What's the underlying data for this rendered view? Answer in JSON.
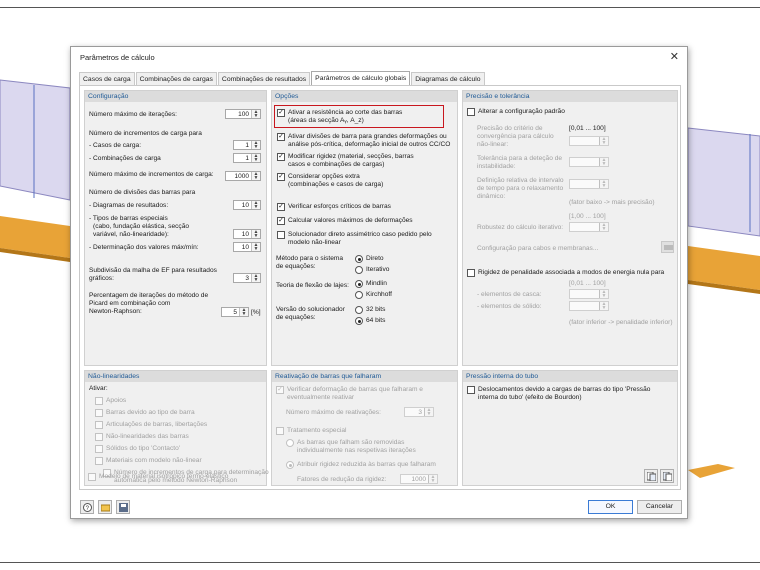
{
  "dialog": {
    "title": "Parâmetros de cálculo",
    "tabs": [
      "Casos de carga",
      "Combinações de cargas",
      "Combinações de resultados",
      "Parâmetros de cálculo globais",
      "Diagramas de cálculo"
    ],
    "active_tab": "Parâmetros de cálculo globais"
  },
  "config": {
    "header": "Configuração",
    "max_iter_label": "Número máximo de iterações:",
    "max_iter": "100",
    "load_incr_title": "Número de incrementos de carga para",
    "load_cases_label": "- Casos de carga:",
    "load_cases": "1",
    "load_combos_label": "- Combinações de carga",
    "load_combos": "1",
    "max_load_incr_label": "Número máximo de incrementos de carga:",
    "max_load_incr": "1000",
    "member_div_title": "Número de divisões das barras para",
    "result_diag_label": "- Diagramas de resultados:",
    "result_diag": "10",
    "special_types_1": "- Tipos de barras especiais",
    "special_types_2": "(cabo, fundação elástica, secção",
    "special_types_3": "variável, não-linearidade):",
    "special_types": "10",
    "maxmin_label": "- Determinação dos valores máx/mín:",
    "maxmin": "10",
    "fe_mesh_1": "Subdivisão da malha de EF para resultados",
    "fe_mesh_2": "gráficos:",
    "fe_mesh": "3",
    "picard_1": "Percentagem de iterações do método de",
    "picard_2": "Picard em combinação com",
    "picard_3": "Newton-Raphson:",
    "picard": "5",
    "picard_unit": "[%]"
  },
  "options": {
    "header": "Opções",
    "shear_1": "Ativar a resistência ao corte das barras",
    "shear_2": "(áreas da secção Aᵧ, A_z)",
    "div_large_1": "Ativar divisões de barra para grandes deformações ou",
    "div_large_2": "análise pós-crítica, deformação inicial de outros CC/CO",
    "modify_1": "Modificar rigidez (material, secções, barras",
    "modify_2": "casos e combinações de cargas)",
    "extra_1": "Considerar opções extra",
    "extra_2": "(combinações e casos de carga)",
    "critical_forces": "Verificar esforços críticos de barras",
    "maxvals": "Calcular valores máximos de deformações",
    "direct_1": "Solucionador direto assimétrico caso pedido pelo",
    "direct_2": "modelo não-linear",
    "method_1": "Método para o sistema",
    "method_2": "de equações:",
    "method_direct": "Direto",
    "method_iter": "Iterativo",
    "plate_label": "Teoria de flexão de lajes:",
    "plate_mindlin": "Mindlin",
    "plate_kirchhoff": "Kirchhoff",
    "solver_1": "Versão do solucionador",
    "solver_2": "de equações:",
    "solver_32": "32 bits",
    "solver_64": "64 bits"
  },
  "precision": {
    "header": "Precisão e tolerância",
    "alter": "Alterar a configuração padrão",
    "conv_1": "Precisão do critério de",
    "conv_2": "convergência para cálculo",
    "conv_3": "não-linear:",
    "conv_range": "[0,01 ... 100]",
    "tol_1": "Tolerância para a deteção de",
    "tol_2": "instabilidade:",
    "rel_1": "Definição relativa de intervalo",
    "rel_2": "de tempo para o relaxamento",
    "rel_3": "dinâmico:",
    "factor_note": "(fator baixo -> mais precisão)",
    "robust_range": "[1,00 ... 100]",
    "robust_label": "Robustez do cálculo iterativo:",
    "cables_label": "Configuração para cabos e membranas...",
    "penalty": "Rigidez de penalidade associada a modos de energia nula para",
    "penalty_range": "[0,01 ... 100]",
    "shell_label": "- elementos de casca:",
    "solid_label": "- elementos de sólido:",
    "penalty_note": "(fator inferior -> penalidade inferior)"
  },
  "nonlinear": {
    "header": "Não-linearidades",
    "activate": "Ativar:",
    "items": [
      "Apoios",
      "Barras devido ao tipo de barra",
      "Articulações de barras, libertações",
      "Não-linearidades das barras",
      "Sólidos do tipo 'Contacto'",
      "Materiais com modelo não-linear"
    ],
    "incr_1": "Número de incrementos de carga para determinação",
    "incr_2": "automática pelo método Newton-Raphson",
    "iso": "Modelo de material isotrópico termo-elástico"
  },
  "reactivation": {
    "header": "Reativação de barras que falharam",
    "verify_1": "Verificar deformação de barras que falharam e",
    "verify_2": "eventualmente reativar",
    "max_label": "Número máximo de reativações:",
    "max": "3",
    "special": "Tratamento especial",
    "removed_1": "As barras que falham são removidas",
    "removed_2": "individualmente nas respetivas iterações",
    "reduced": "Atribuir rigidez reduzida às barras que falharam",
    "factor_label": "Fatores de redução da rigidez:",
    "factor": "1000"
  },
  "pipe": {
    "header": "Pressão interna do tubo",
    "bourdon_1": "Deslocamentos devido a cargas de barras do tipo 'Pressão",
    "bourdon_2": "interna do tubo' (efeito de Bourdon)"
  },
  "buttons": {
    "ok": "OK",
    "cancel": "Cancelar"
  },
  "colors": {
    "accent": "#3a7bd5",
    "highlight": "#c8171e",
    "header_text": "#1f5a96",
    "model_orange": "#e9a33a",
    "model_lavender": "#d9d6ee"
  }
}
